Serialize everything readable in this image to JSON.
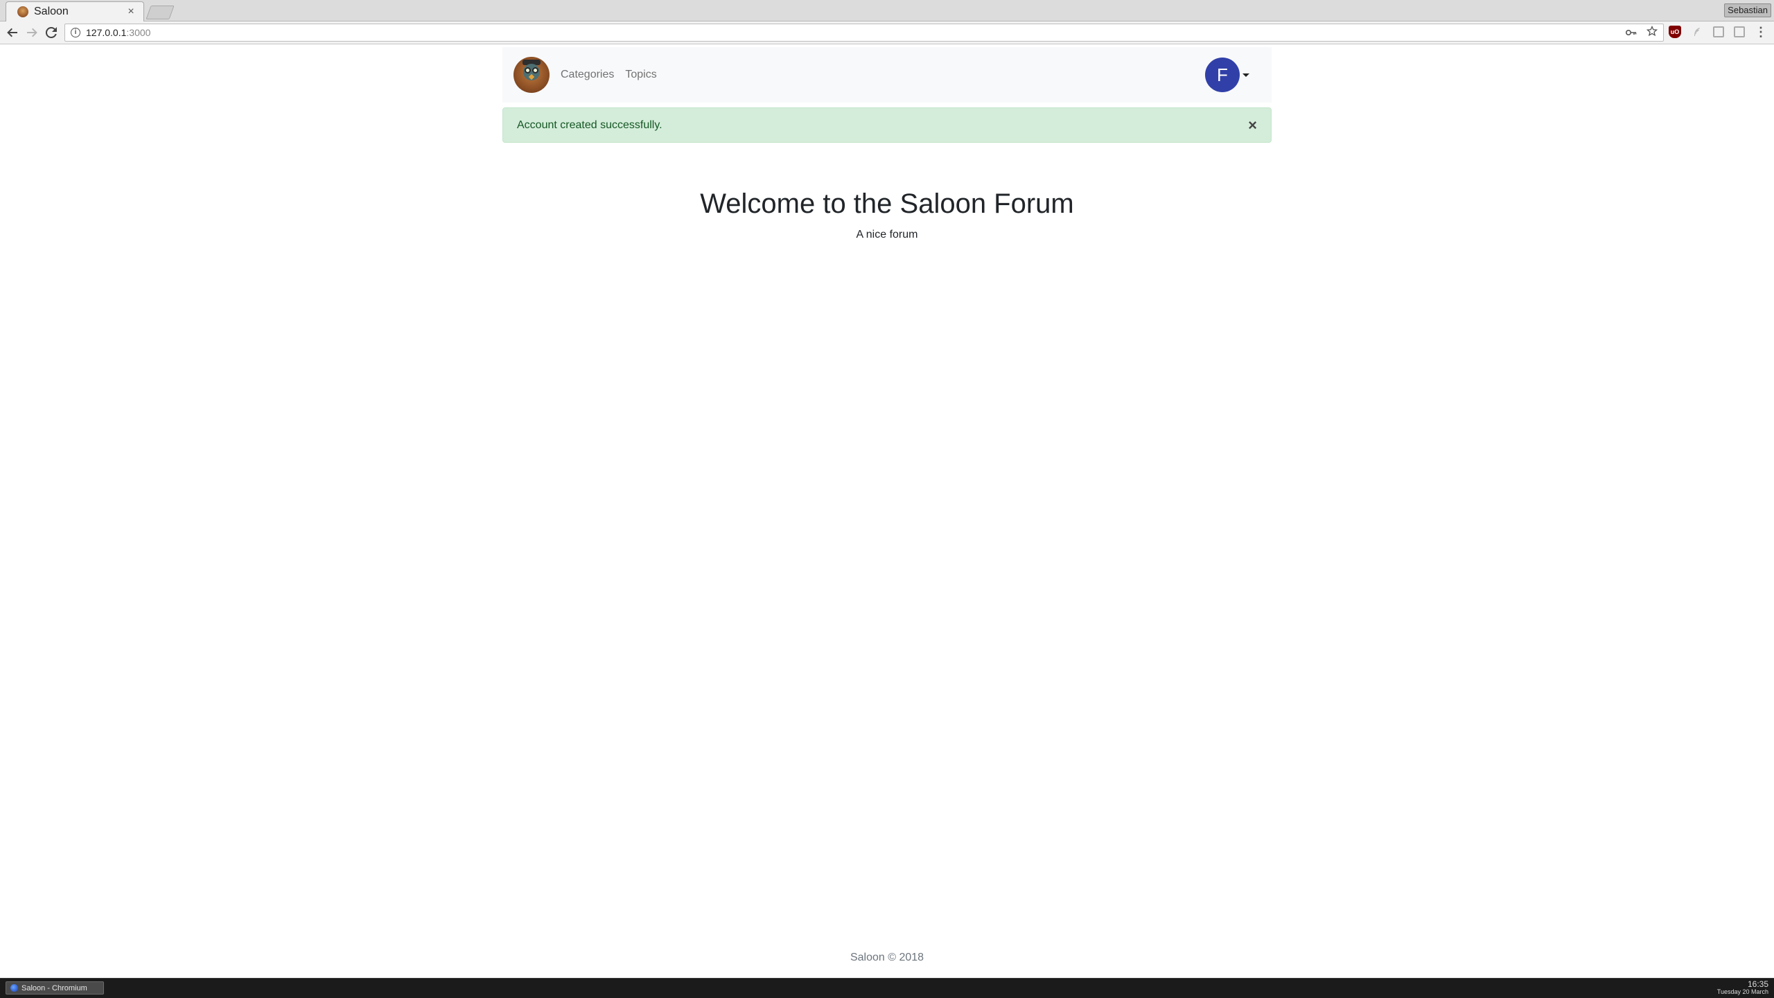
{
  "browser": {
    "tab_title": "Saloon",
    "tab_close": "×",
    "profile_name": "Sebastian",
    "url_host": "127.0.0.1",
    "url_port": ":3000"
  },
  "site_nav": {
    "links": [
      {
        "label": "Categories"
      },
      {
        "label": "Topics"
      }
    ],
    "avatar_initial": "F"
  },
  "alert": {
    "message": "Account created successfully.",
    "close": "×"
  },
  "hero": {
    "title": "Welcome to the Saloon Forum",
    "subtitle": "A nice forum"
  },
  "footer": {
    "text": "Saloon © 2018"
  },
  "taskbar": {
    "window_label": "Saloon - Chromium",
    "time": "16:35",
    "date": "Tuesday 20 March"
  },
  "colors": {
    "navbar_bg": "#f8f9fa",
    "alert_bg": "#d4edda",
    "alert_text": "#155724",
    "avatar_bg": "#3140a8"
  }
}
